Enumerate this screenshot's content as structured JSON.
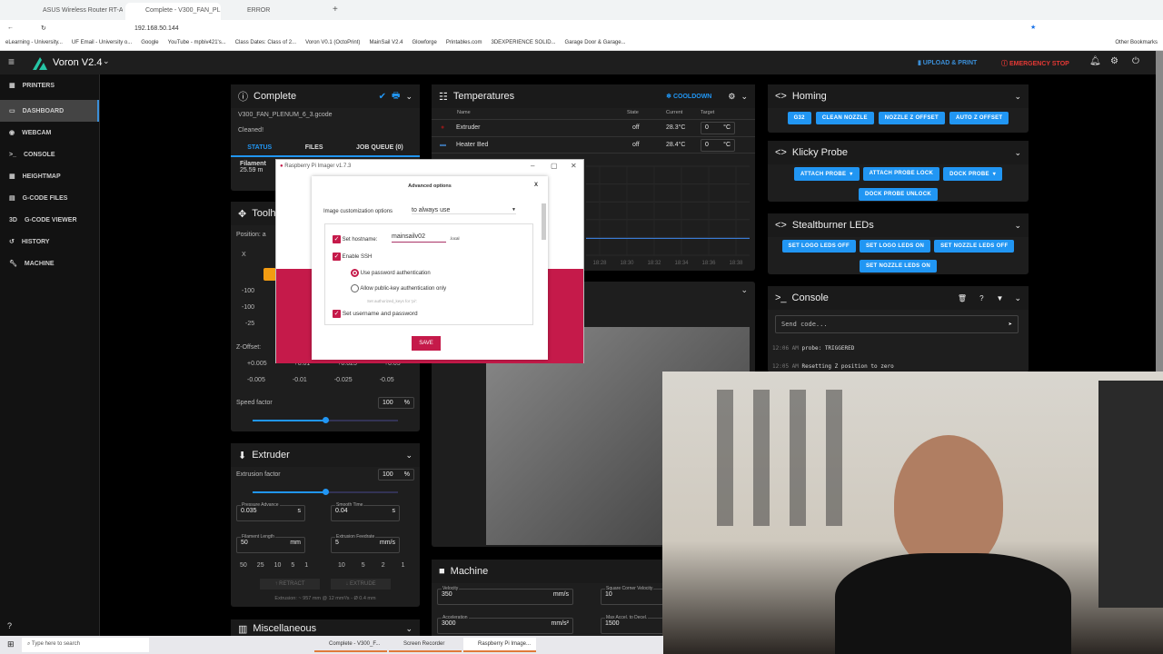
{
  "browser": {
    "tabs": [
      {
        "label": "ASUS Wireless Router RT-AX55"
      },
      {
        "label": "Complete - V300_FAN_PLENUM_6"
      },
      {
        "label": "ERROR"
      }
    ],
    "url": "192.168.50.144",
    "bookmarks": [
      "eLearning - University...",
      "UF Email - University o...",
      "Google",
      "YouTube - mpbiv421's...",
      "Class Dates: Class of 2...",
      "Voron V0.1 (OctoPrint)",
      "MainSail V2.4",
      "Glowforge",
      "Printables.com",
      "3DEXPERIENCE SOLID...",
      "Garage Door & Garage..."
    ],
    "other_bookmarks": "Other Bookmarks"
  },
  "app": {
    "printer": "Voron V2.4",
    "upload": "UPLOAD & PRINT",
    "estop": "EMERGENCY STOP"
  },
  "sidebar": {
    "items": [
      {
        "label": "PRINTERS"
      },
      {
        "label": "DASHBOARD"
      },
      {
        "label": "WEBCAM"
      },
      {
        "label": "CONSOLE"
      },
      {
        "label": "HEIGHTMAP"
      },
      {
        "label": "G-CODE FILES"
      },
      {
        "label": "G-CODE VIEWER"
      },
      {
        "label": "HISTORY"
      },
      {
        "label": "MACHINE"
      }
    ]
  },
  "status": {
    "title": "Complete",
    "file": "V300_FAN_PLENUM_6_3.gcode",
    "message": "Cleaned!",
    "tabs": [
      "STATUS",
      "FILES",
      "JOB QUEUE (0)"
    ],
    "filament_label": "Filament",
    "filament_value": "25.59 m"
  },
  "toolhead": {
    "title": "Toolhead",
    "position": "Position: a",
    "axis": "X",
    "rows": [
      [
        "-100",
        "-10"
      ],
      [
        "-100",
        "-10"
      ],
      [
        "-25",
        "-1"
      ]
    ],
    "zoffset": "Z-Offset:",
    "zup": [
      "+0.005",
      "+0.01",
      "+0.025",
      "+0.05"
    ],
    "zdown": [
      "-0.005",
      "-0.01",
      "-0.025",
      "-0.05"
    ],
    "speed_label": "Speed factor",
    "speed_value": "100",
    "speed_unit": "%",
    "speed_fraction": 0.5
  },
  "extruder": {
    "title": "Extruder",
    "factor_label": "Extrusion factor",
    "factor_value": "100",
    "factor_unit": "%",
    "factor_fraction": 0.5,
    "pa_label": "Pressure Advance",
    "pa_value": "0.035",
    "pa_unit": "s",
    "st_label": "Smooth Time",
    "st_value": "0.04",
    "st_unit": "s",
    "fl_label": "Filament Length",
    "fl_value": "50",
    "fl_unit": "mm",
    "ef_label": "Extrusion Feedrate",
    "ef_value": "5",
    "ef_unit": "mm/s",
    "lengths": [
      "50",
      "25",
      "10",
      "5",
      "1"
    ],
    "feeds": [
      "10",
      "5",
      "2",
      "1"
    ],
    "retract": "RETRACT",
    "extrude": "EXTRUDE",
    "info": "Extrusion: ~ 957 mm @ 12 mm³/s - Ø 0.4 mm"
  },
  "misc": {
    "title": "Miscellaneous"
  },
  "temps": {
    "title": "Temperatures",
    "cooldown": "COOLDOWN",
    "headers": [
      "Name",
      "State",
      "Current",
      "Target"
    ],
    "rows": [
      {
        "name": "Extruder",
        "state": "off",
        "current": "28.3°C",
        "target": "0",
        "unit": "°C"
      },
      {
        "name": "Heater Bed",
        "state": "off",
        "current": "28.4°C",
        "target": "0",
        "unit": "°C"
      }
    ]
  },
  "chart_data": {
    "type": "line",
    "x": [
      "18:28",
      "18:30",
      "18:32",
      "18:34",
      "18:36",
      "18:38"
    ],
    "series": [
      {
        "name": "Heater Bed",
        "values": [
          28.4,
          28.4,
          28.4,
          28.4,
          28.4,
          28.4
        ]
      }
    ],
    "ylim": [
      0,
      150
    ]
  },
  "machine": {
    "title": "Machine",
    "velocity_label": "Velocity",
    "velocity": "350",
    "velocity_unit": "mm/s",
    "accel_label": "Acceleration",
    "accel": "3000",
    "accel_unit": "mm/s²",
    "scv_label": "Square Corner Velocity",
    "scv": "10",
    "decel_label": "Max Accel. to Decel.",
    "decel": "1500"
  },
  "homing": {
    "title": "Homing",
    "buttons": [
      "G32",
      "CLEAN NOZZLE",
      "NOZZLE Z OFFSET",
      "AUTO Z OFFSET"
    ]
  },
  "klicky": {
    "title": "Klicky Probe",
    "buttons": [
      "ATTACH PROBE",
      "ATTACH PROBE LOCK",
      "DOCK PROBE",
      "DOCK PROBE UNLOCK"
    ]
  },
  "leds": {
    "title": "Stealtburner LEDs",
    "buttons": [
      "SET LOGO LEDS OFF",
      "SET LOGO LEDS ON",
      "SET NOZZLE LEDS OFF",
      "SET NOZZLE LEDS ON"
    ]
  },
  "console": {
    "title": "Console",
    "placeholder": "Send code...",
    "lines": [
      {
        "time": "12:06 AM",
        "text": "probe: TRIGGERED"
      },
      {
        "time": "12:05 AM",
        "text": "Resetting Z position to zero"
      }
    ]
  },
  "imager": {
    "title": "Raspberry Pi Imager v1.7.3",
    "dialog_title": "Advanced options",
    "custom_label": "Image customization options",
    "custom_value": "to always use",
    "hostname_label": "Set hostname:",
    "hostname": "mainsailv02",
    "local": ".local",
    "ssh": "Enable SSH",
    "pw_auth": "Use password authentication",
    "pk_auth": "Allow public-key authentication only",
    "keys": "Set authorized_keys for 'pi':",
    "userpass": "Set username and password",
    "save": "SAVE"
  },
  "taskbar": {
    "search": "Type here to search",
    "apps": [
      "Complete - V300_F...",
      "Screen Recorder",
      "Raspberry Pi Image..."
    ]
  }
}
